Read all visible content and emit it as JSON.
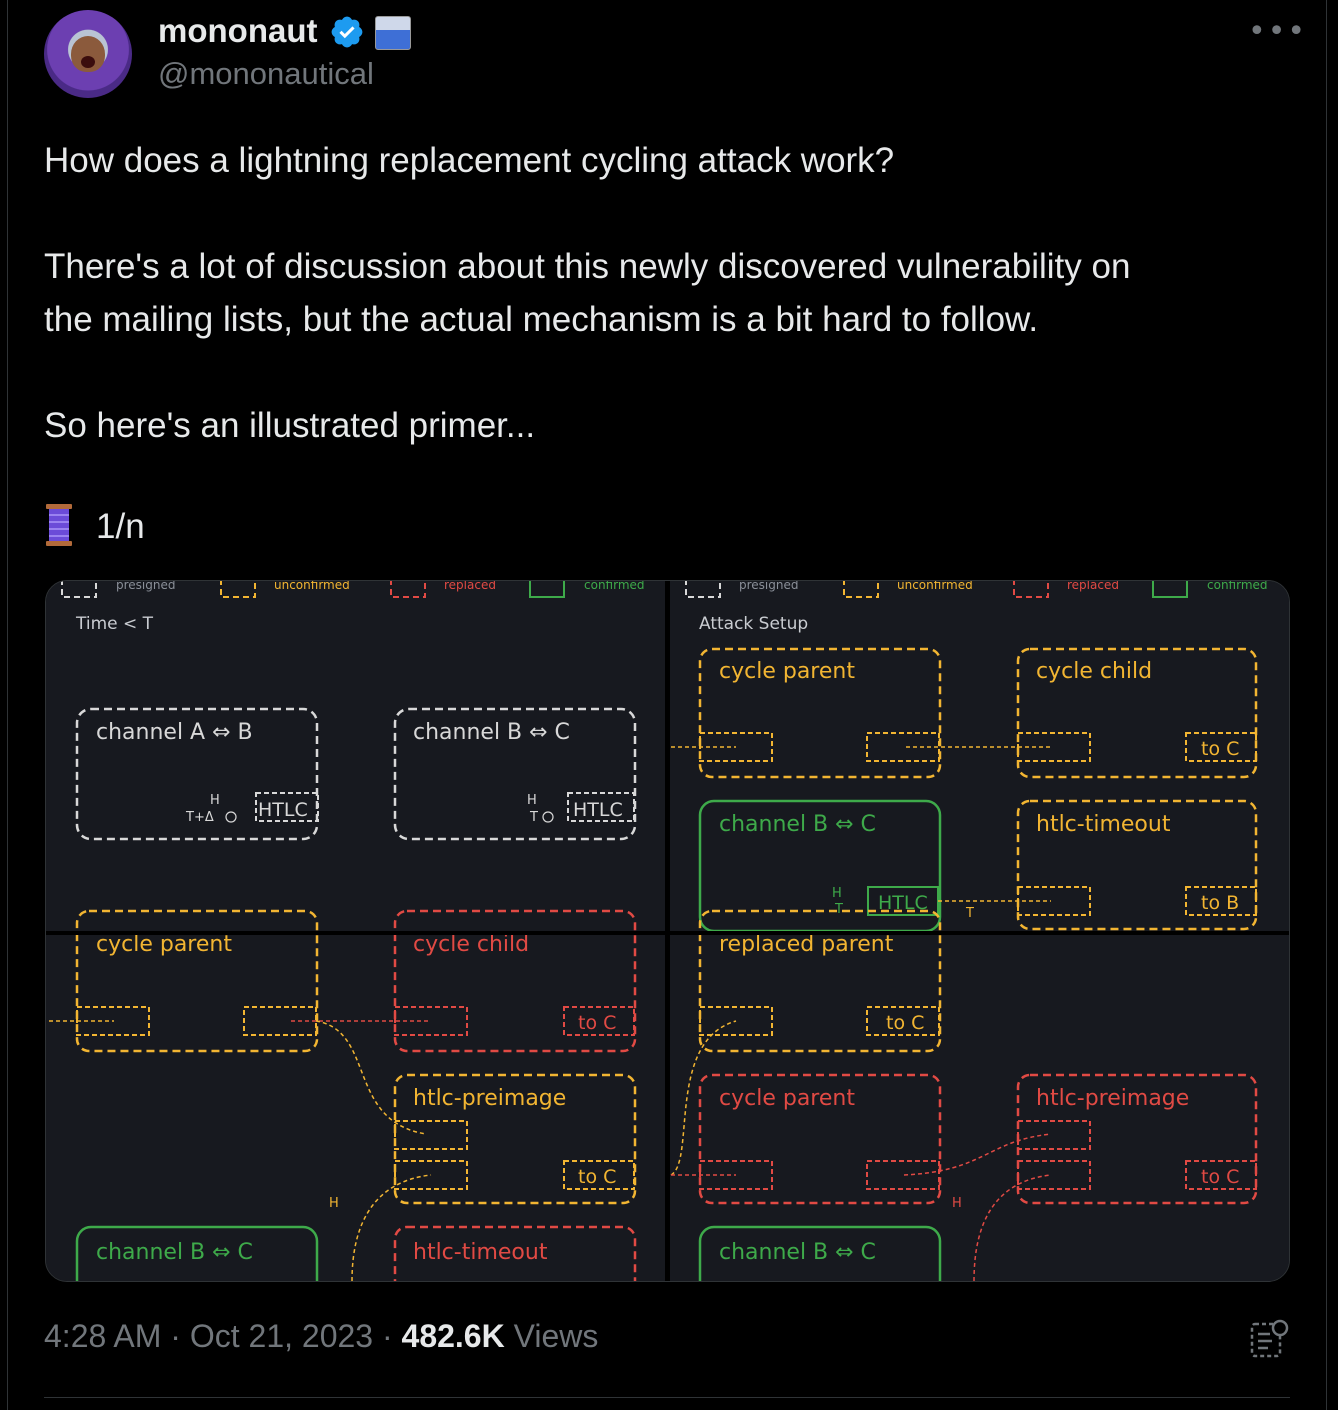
{
  "author": {
    "name": "mononaut",
    "handle": "@mononautical"
  },
  "tweet": {
    "line1": "How does a lightning replacement cycling attack work?",
    "line2": "There's a lot of discussion about this newly discovered vulnerability on",
    "line3": "the mailing lists, but the actual mechanism is a bit hard to follow.",
    "line4": "So here's an illustrated primer...",
    "thread": "1/n"
  },
  "diagram": {
    "legend": [
      "presigned",
      "unconfirmed",
      "replaced",
      "confirmed"
    ],
    "tl": {
      "caption": "Time < T",
      "box1": "channel A ⇔ B",
      "box2": "channel B ⇔ C",
      "htlc": "HTLC",
      "hash": "H",
      "t1": "T+Δ",
      "t2": "T"
    },
    "tr": {
      "caption": "Attack Setup",
      "parent": "cycle parent",
      "child": "cycle child",
      "channel": "channel B ⇔ C",
      "timeout": "htlc-timeout",
      "to_c": "to C",
      "to_b": "to B",
      "htlc": "HTLC",
      "hash": "H",
      "t": "T"
    },
    "bl": {
      "parent": "cycle parent",
      "child": "cycle child",
      "preimage": "htlc-preimage",
      "channel": "channel B ⇔ C",
      "timeout": "htlc-timeout",
      "to_c": "to C",
      "hash": "H"
    },
    "br": {
      "replaced": "replaced parent",
      "parent": "cycle parent",
      "preimage": "htlc-preimage",
      "channel": "channel B ⇔ C",
      "to_c": "to C",
      "hash": "H"
    }
  },
  "footer": {
    "time": "4:28 AM · Oct 21, 2023 · ",
    "views_count": "482.6K",
    "views_label": " Views"
  },
  "colors": {
    "presigned": "#d8d8d8",
    "unconfirmed": "#f2b532",
    "replaced": "#e14a44",
    "confirmed": "#3eaa4a",
    "verified": "#1d9bf0"
  }
}
